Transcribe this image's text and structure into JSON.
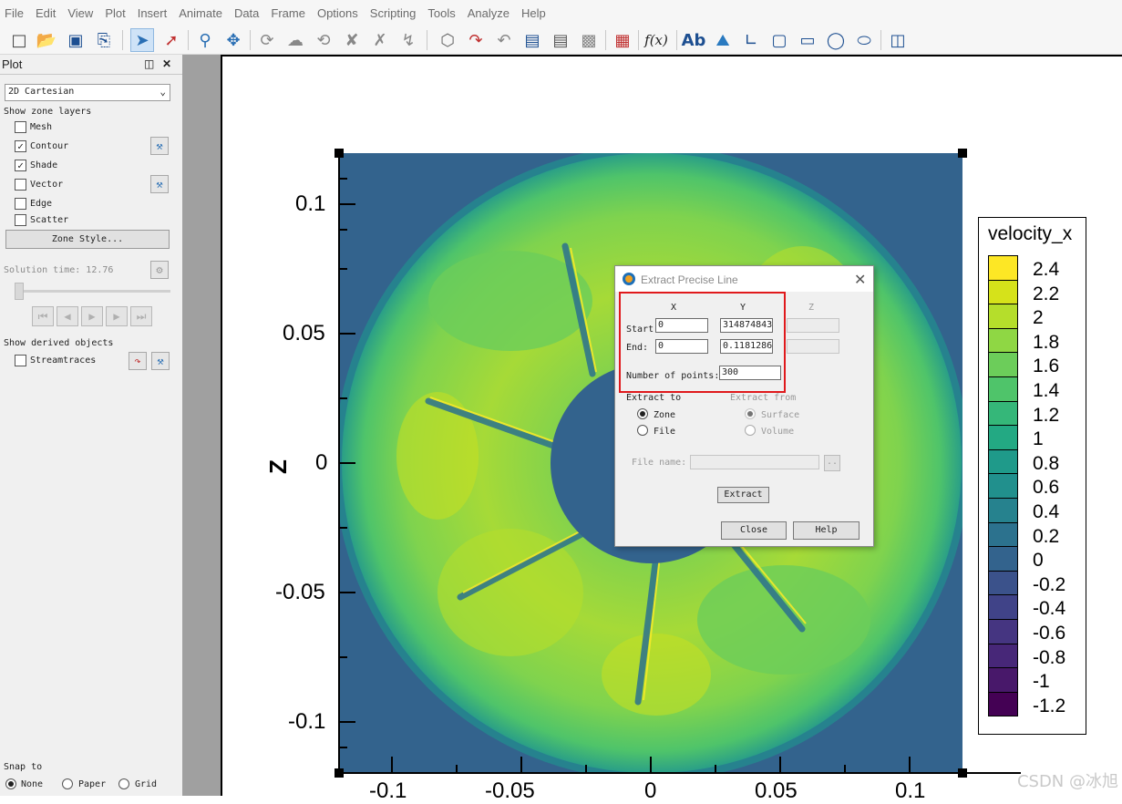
{
  "menu": [
    "File",
    "Edit",
    "View",
    "Plot",
    "Insert",
    "Animate",
    "Data",
    "Frame",
    "Options",
    "Scripting",
    "Tools",
    "Analyze",
    "Help"
  ],
  "toolbar": {
    "icons": [
      "new-layout-icon",
      "open-file-icon",
      "save-icon",
      "print-icon",
      "selector-icon",
      "adjustor-icon",
      "zoom-icon",
      "translate-icon",
      "rotate-icon",
      "spherical-rotate-icon",
      "roller-ball-icon",
      "x-rotate-icon",
      "y-rotate-icon",
      "z-rotate-icon",
      "probe-icon",
      "streamtrace-icon",
      "slice-tool-icon",
      "contour-add-icon",
      "contour-remove-icon",
      "iso-surface-icon",
      "zone-create-icon",
      "equation-icon",
      "text-tool-icon",
      "image-tool-icon",
      "polyline-tool-icon",
      "square-tool-icon",
      "rectangle-tool-icon",
      "circle-tool-icon",
      "ellipse-tool-icon",
      "frame-tool-icon"
    ],
    "equation_glyph": "f(x)",
    "text_glyph": "Ab"
  },
  "sidebar": {
    "title": "Plot",
    "plot_type": "2D Cartesian",
    "zone_layers_label": "Show zone layers",
    "layers": [
      {
        "label": "Mesh",
        "checked": false
      },
      {
        "label": "Contour",
        "checked": true
      },
      {
        "label": "Shade",
        "checked": true
      },
      {
        "label": "Vector",
        "checked": false
      },
      {
        "label": "Edge",
        "checked": false
      },
      {
        "label": "Scatter",
        "checked": false
      }
    ],
    "zone_style_button": "Zone Style...",
    "solution_time_label": "Solution time: 12.76",
    "derived_label": "Show derived objects",
    "streamtraces_label": "Streamtraces",
    "streamtraces_checked": false,
    "snap_label": "Snap to",
    "snap_options": [
      {
        "label": "None",
        "selected": true
      },
      {
        "label": "Paper",
        "selected": false
      },
      {
        "label": "Grid",
        "selected": false
      }
    ]
  },
  "plot": {
    "y_axis_label": "Z",
    "y_ticks": [
      "0.1",
      "0.05",
      "0",
      "-0.05",
      "-0.1"
    ],
    "x_ticks": [
      "-0.1",
      "-0.05",
      "0",
      "0.05",
      "0.1"
    ]
  },
  "legend": {
    "title": "velocity_x",
    "labels": [
      "2.4",
      "2.2",
      "2",
      "1.8",
      "1.6",
      "1.4",
      "1.2",
      "1",
      "0.8",
      "0.6",
      "0.4",
      "0.2",
      "0",
      "-0.2",
      "-0.4",
      "-0.6",
      "-0.8",
      "-1",
      "-1.2"
    ],
    "colors": [
      "#fde725",
      "#d6e21a",
      "#b5de2b",
      "#8fd744",
      "#6ccd5a",
      "#4fc46a",
      "#35b779",
      "#23a983",
      "#1f9a8a",
      "#21908d",
      "#26828e",
      "#2c728e",
      "#33638d",
      "#3b528b",
      "#404388",
      "#453581",
      "#472778",
      "#48186a",
      "#440154"
    ]
  },
  "dialog": {
    "title": "Extract Precise Line",
    "col_x": "X",
    "col_y": "Y",
    "col_z": "Z",
    "start_label": "Start",
    "end_label": "End:",
    "start_x": "0",
    "start_y": "314874843",
    "end_x": "0",
    "end_y": "0.1181286",
    "num_points_label": "Number of points:",
    "num_points": "300",
    "extract_to_label": "Extract to",
    "extract_from_label": "Extract from",
    "to_zone": "Zone",
    "to_file": "File",
    "from_surface": "Surface",
    "from_volume": "Volume",
    "file_name_label": "File name:",
    "browse_label": "..",
    "extract_button": "Extract",
    "close_button": "Close",
    "help_button": "Help"
  },
  "watermark": "CSDN @冰旭"
}
